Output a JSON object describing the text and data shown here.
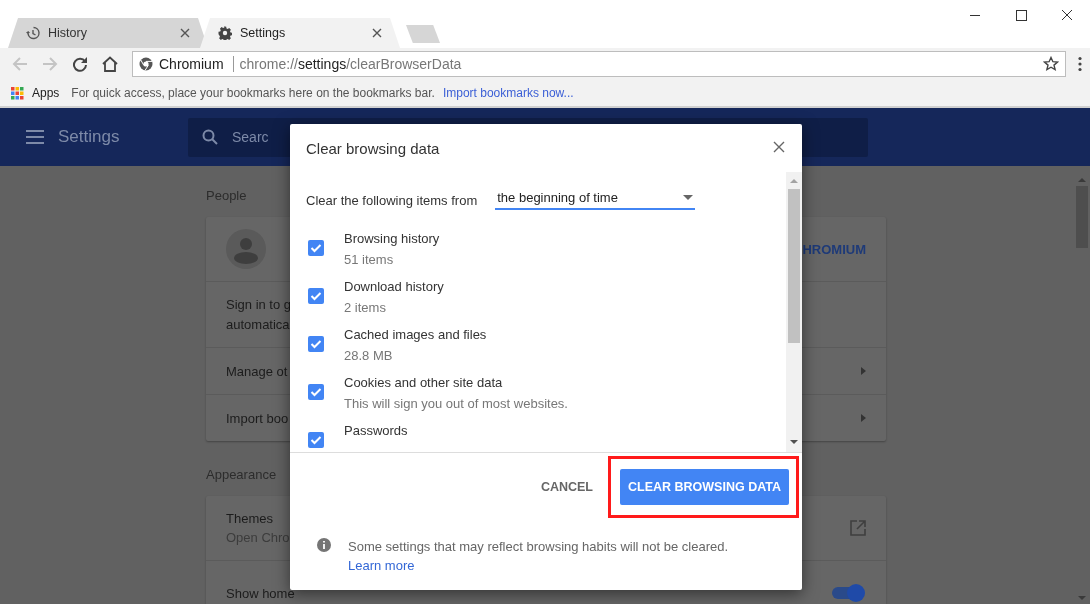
{
  "browser": {
    "tabs": [
      {
        "title": "History",
        "selected": false
      },
      {
        "title": "Settings",
        "selected": true
      }
    ],
    "omnibox": {
      "site": "Chromium",
      "url_scheme": "chrome://",
      "url_host": "settings",
      "url_path": "/clearBrowserData"
    },
    "bookmarks_bar": {
      "apps": "Apps",
      "hint": "For quick access, place your bookmarks here on the bookmarks bar.",
      "import_link": "Import bookmarks now..."
    }
  },
  "settings_page": {
    "title": "Settings",
    "search_placeholder": "Searc",
    "people_heading": "People",
    "sign_in_button": "HROMIUM",
    "sign_in_text": [
      "Sign in to g",
      "automatica"
    ],
    "people_rows": [
      {
        "label": "Manage ot"
      },
      {
        "label": "Import boo"
      }
    ],
    "appearance_heading": "Appearance",
    "appearance_rows": [
      {
        "kind": "link",
        "label": "Themes",
        "sublabel": "Open Chro"
      },
      {
        "kind": "toggle",
        "label": "Show home",
        "on": true
      }
    ]
  },
  "dialog": {
    "title": "Clear browsing data",
    "range_label": "Clear the following items from",
    "range_value": "the beginning of time",
    "items": [
      {
        "label": "Browsing history",
        "detail": "51 items",
        "checked": true
      },
      {
        "label": "Download history",
        "detail": "2 items",
        "checked": true
      },
      {
        "label": "Cached images and files",
        "detail": "28.8 MB",
        "checked": true
      },
      {
        "label": "Cookies and other site data",
        "detail": "This will sign you out of most websites.",
        "checked": true
      },
      {
        "label": "Passwords",
        "checked": true
      }
    ],
    "buttons": [
      {
        "label": "CANCEL",
        "kind": "text",
        "highlighted": false
      },
      {
        "label": "CLEAR BROWSING DATA",
        "kind": "primary",
        "highlighted": true
      }
    ],
    "note": "Some settings that may reflect browsing habits will not be cleared.",
    "note_link": "Learn more"
  }
}
